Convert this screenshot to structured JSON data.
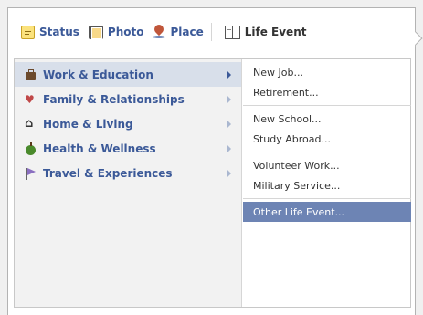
{
  "composer": {
    "tabs": [
      {
        "label": "Status",
        "icon": "status-icon"
      },
      {
        "label": "Photo",
        "icon": "photo-icon"
      },
      {
        "label": "Place",
        "icon": "place-icon"
      },
      {
        "label": "Life Event",
        "icon": "life-event-icon",
        "active": true
      }
    ]
  },
  "categories": [
    {
      "label": "Work & Education",
      "icon": "briefcase-icon",
      "active": true
    },
    {
      "label": "Family & Relationships",
      "icon": "heart-icon"
    },
    {
      "label": "Home & Living",
      "icon": "house-icon"
    },
    {
      "label": "Health & Wellness",
      "icon": "apple-icon"
    },
    {
      "label": "Travel & Experiences",
      "icon": "flag-icon"
    }
  ],
  "events": {
    "group1": [
      "New Job...",
      "Retirement..."
    ],
    "group2": [
      "New School...",
      "Study Abroad..."
    ],
    "group3": [
      "Volunteer Work...",
      "Military Service..."
    ],
    "other": "Other Life Event..."
  },
  "colors": {
    "link": "#3b5998",
    "highlight": "#6d84b4",
    "active_category_bg": "#d8dfea"
  }
}
